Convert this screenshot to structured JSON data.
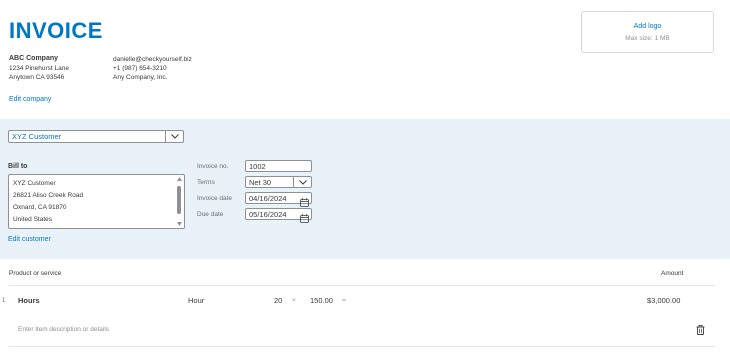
{
  "header": {
    "title": "INVOICE",
    "company": {
      "name": "ABC Company",
      "address_line1": "1234 Pinehurst Lane",
      "address_line2": "Anytown CA 93546",
      "email": "danielle@checkyourself.biz",
      "phone": "+1 (987) 654-3210",
      "legal_name": "Any Company, Inc."
    },
    "edit_company_label": "Edit company",
    "logo": {
      "add_label": "Add logo",
      "size_hint": "Max size: 1 MB"
    }
  },
  "customer": {
    "selected": "XYZ Customer",
    "bill_to_label": "Bill to",
    "bill_to_lines": [
      "XYZ Customer",
      "26821 Aliso Creek Road",
      "Oxnard, CA  91870",
      "United States"
    ],
    "edit_customer_label": "Edit customer"
  },
  "invoice_details": {
    "invoice_no_label": "Invoice no.",
    "invoice_no": "1002",
    "terms_label": "Terms",
    "terms": "Net 30",
    "invoice_date_label": "Invoice date",
    "invoice_date": "04/16/2024",
    "due_date_label": "Due date",
    "due_date": "05/16/2024"
  },
  "line_items": {
    "product_header": "Product or service",
    "amount_header": "Amount",
    "items": [
      {
        "index": "1",
        "name": "Hours",
        "unit": "Hour",
        "qty": "20",
        "times": "×",
        "rate": "150.00",
        "equals": "=",
        "amount": "$3,000.00",
        "description_placeholder": "Enter item description or details"
      }
    ]
  },
  "colors": {
    "accent": "#0077c5",
    "band": "#eaf2f9",
    "text": "#393a3d"
  },
  "icons": [
    "chevron-down-icon",
    "calendar-icon",
    "trash-icon"
  ]
}
